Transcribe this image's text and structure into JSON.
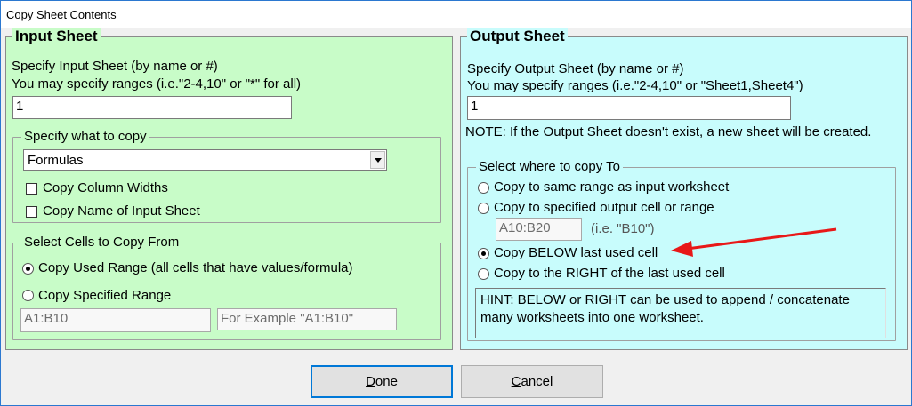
{
  "window": {
    "title": "Copy Sheet Contents"
  },
  "input_sheet": {
    "legend": "Input Sheet",
    "line1": "Specify Input Sheet (by name or #)",
    "line2": "You may specify ranges (i.e.\"2-4,10\" or \"*\" for all)",
    "value": "1",
    "what_to_copy": {
      "legend": "Specify what to copy",
      "selected": "Formulas",
      "copy_column_widths": "Copy Column Widths",
      "copy_name": "Copy Name of Input Sheet"
    },
    "cells_from": {
      "legend": "Select Cells to Copy From",
      "used_range": "Copy Used Range (all cells that have values/formula)",
      "specified_range": "Copy Specified Range",
      "range_value": "A1:B10",
      "example": "For Example \"A1:B10\""
    }
  },
  "output_sheet": {
    "legend": "Output Sheet",
    "line1": "Specify Output Sheet (by name or #)",
    "line2": "You may specify ranges (i.e.\"2-4,10\" or \"Sheet1,Sheet4\")",
    "value": "1",
    "note": "NOTE: If the Output Sheet doesn't exist, a new sheet will be created.",
    "copy_to": {
      "legend": "Select where to copy To",
      "same_range": "Copy to same range as input worksheet",
      "specified": "Copy to specified output cell or range",
      "specified_value": "A10:B20",
      "specified_hint": "(i.e. \"B10\")",
      "below": "Copy BELOW last used cell",
      "right": "Copy to the RIGHT of the last used cell",
      "hint": "HINT: BELOW or RIGHT can be used to append / concatenate many worksheets into one worksheet."
    }
  },
  "buttons": {
    "done_mnemonic": "D",
    "done_rest": "one",
    "cancel_mnemonic": "C",
    "cancel_rest": "ancel"
  },
  "colors": {
    "input_bg": "#c8fcc8",
    "output_bg": "#c8fcfc",
    "arrow": "#e81818"
  }
}
